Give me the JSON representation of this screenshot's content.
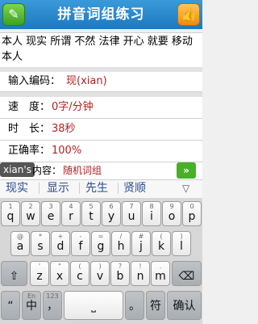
{
  "header": {
    "title": "拼音词组练习",
    "left_icon": "pencil-icon",
    "right_icon": "thumbs-up-icon"
  },
  "text_area": {
    "content": "本人 现实 所谓 不然 法律 开心 就要 移动 本人"
  },
  "stats": {
    "input_code_label": "输入编码：",
    "input_code_value": "现(xian)",
    "speed_label": "速　度：",
    "speed_value": "0字/分钟",
    "duration_label": "时　长：",
    "duration_value": "38秒",
    "accuracy_label": "正确率：",
    "accuracy_value": "100%"
  },
  "content_row": {
    "tooltip": "xian's",
    "label": "内容：",
    "value": "随机词组"
  },
  "candidates": [
    "现实",
    "显示",
    "先生",
    "贤顺"
  ],
  "keyboard": {
    "row1": [
      [
        "1",
        "q"
      ],
      [
        "2",
        "w"
      ],
      [
        "3",
        "e"
      ],
      [
        "4",
        "r"
      ],
      [
        "5",
        "t"
      ],
      [
        "6",
        "y"
      ],
      [
        "7",
        "u"
      ],
      [
        "8",
        "i"
      ],
      [
        "9",
        "o"
      ],
      [
        "0",
        "p"
      ]
    ],
    "row2": [
      [
        "@",
        "a"
      ],
      [
        "*",
        "s"
      ],
      [
        "+",
        "d"
      ],
      [
        "-",
        "f"
      ],
      [
        "=",
        "g"
      ],
      [
        "/",
        "h"
      ],
      [
        "#",
        "j"
      ],
      [
        "(",
        "k"
      ],
      [
        ")",
        "l"
      ]
    ],
    "row3": [
      [
        "",
        ""
      ],
      [
        "'",
        "z"
      ],
      [
        "\"",
        "x"
      ],
      [
        "(",
        "c"
      ],
      [
        ")",
        "v"
      ],
      [
        "?",
        "b"
      ],
      [
        "!",
        "n"
      ],
      [
        ".",
        "m"
      ]
    ],
    "space_label": "",
    "lang_top": "En",
    "lang_label": "中",
    "symbols_top": "123",
    "comma": "，",
    "period": "。",
    "symbol_key": "符",
    "enter_label": "确认"
  }
}
